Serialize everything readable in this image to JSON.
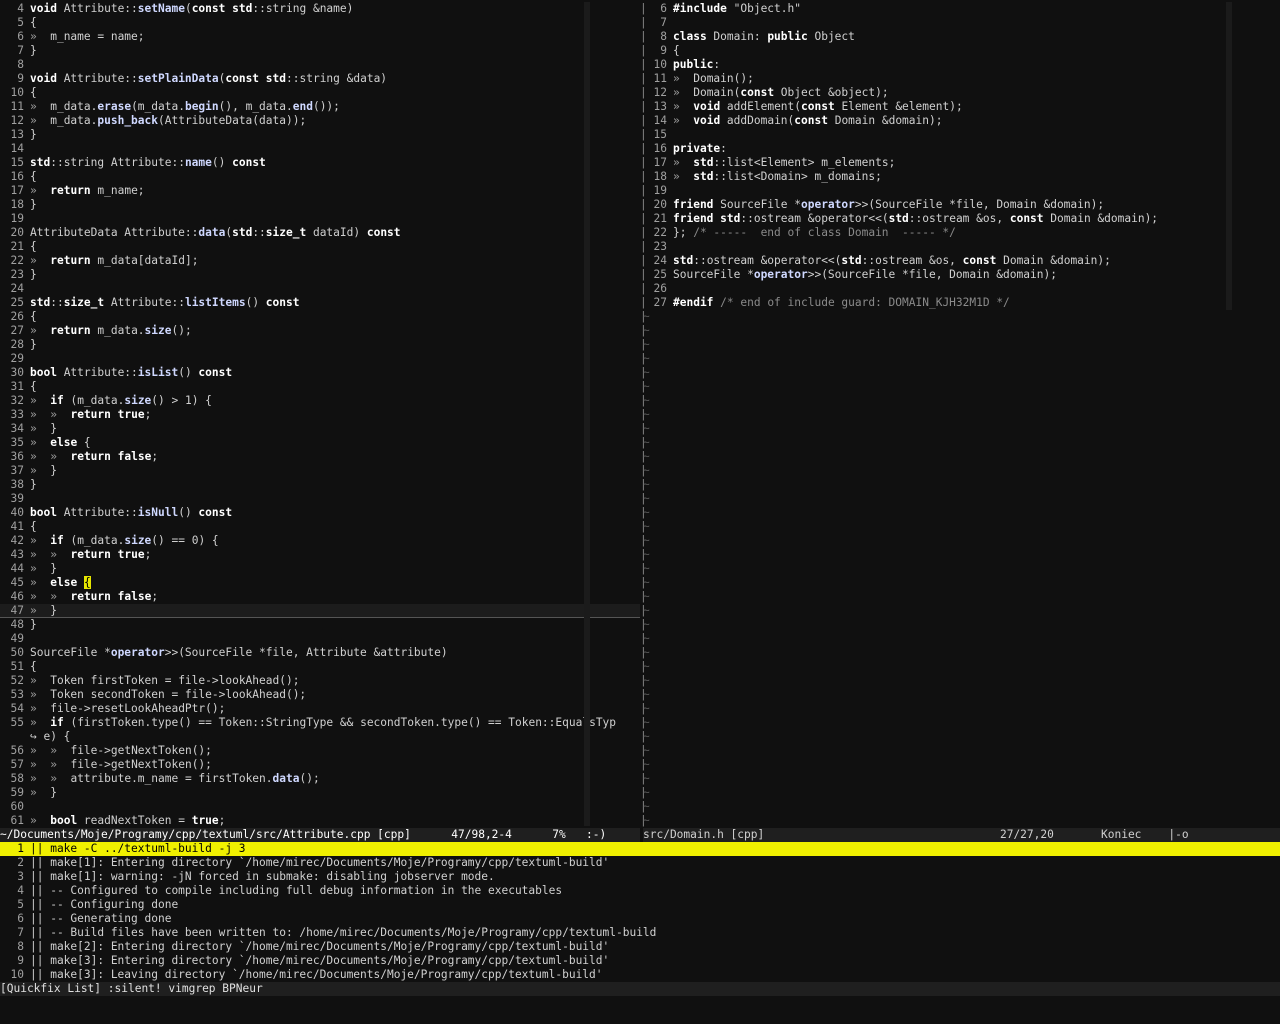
{
  "left_pane": {
    "lines": [
      {
        "n": "4",
        "t": "void Attribute::setName(const std::string &name)"
      },
      {
        "n": "5",
        "t": "{"
      },
      {
        "n": "6",
        "t": "»  m_name = name;"
      },
      {
        "n": "7",
        "t": "}"
      },
      {
        "n": "8",
        "t": ""
      },
      {
        "n": "9",
        "t": "void Attribute::setPlainData(const std::string &data)"
      },
      {
        "n": "10",
        "t": "{"
      },
      {
        "n": "11",
        "t": "»  m_data.erase(m_data.begin(), m_data.end());"
      },
      {
        "n": "12",
        "t": "»  m_data.push_back(AttributeData(data));"
      },
      {
        "n": "13",
        "t": "}"
      },
      {
        "n": "14",
        "t": ""
      },
      {
        "n": "15",
        "t": "std::string Attribute::name() const"
      },
      {
        "n": "16",
        "t": "{"
      },
      {
        "n": "17",
        "t": "»  return m_name;"
      },
      {
        "n": "18",
        "t": "}"
      },
      {
        "n": "19",
        "t": ""
      },
      {
        "n": "20",
        "t": "AttributeData Attribute::data(std::size_t dataId) const"
      },
      {
        "n": "21",
        "t": "{"
      },
      {
        "n": "22",
        "t": "»  return m_data[dataId];"
      },
      {
        "n": "23",
        "t": "}"
      },
      {
        "n": "24",
        "t": ""
      },
      {
        "n": "25",
        "t": "std::size_t Attribute::listItems() const"
      },
      {
        "n": "26",
        "t": "{"
      },
      {
        "n": "27",
        "t": "»  return m_data.size();"
      },
      {
        "n": "28",
        "t": "}"
      },
      {
        "n": "29",
        "t": ""
      },
      {
        "n": "30",
        "t": "bool Attribute::isList() const"
      },
      {
        "n": "31",
        "t": "{"
      },
      {
        "n": "32",
        "t": "»  if (m_data.size() > 1) {"
      },
      {
        "n": "33",
        "t": "»  »  return true;"
      },
      {
        "n": "34",
        "t": "»  }"
      },
      {
        "n": "35",
        "t": "»  else {"
      },
      {
        "n": "36",
        "t": "»  »  return false;"
      },
      {
        "n": "37",
        "t": "»  }"
      },
      {
        "n": "38",
        "t": "}"
      },
      {
        "n": "39",
        "t": ""
      },
      {
        "n": "40",
        "t": "bool Attribute::isNull() const"
      },
      {
        "n": "41",
        "t": "{"
      },
      {
        "n": "42",
        "t": "»  if (m_data.size() == 0) {"
      },
      {
        "n": "43",
        "t": "»  »  return true;"
      },
      {
        "n": "44",
        "t": "»  }"
      },
      {
        "n": "45",
        "t": "»  else {"
      },
      {
        "n": "46",
        "t": "»  »  return false;"
      },
      {
        "n": "47",
        "t": "»  }"
      },
      {
        "n": "48",
        "t": "}"
      },
      {
        "n": "49",
        "t": ""
      },
      {
        "n": "50",
        "t": "SourceFile *operator>>(SourceFile *file, Attribute &attribute)"
      },
      {
        "n": "51",
        "t": "{"
      },
      {
        "n": "52",
        "t": "»  Token firstToken = file->lookAhead();"
      },
      {
        "n": "53",
        "t": "»  Token secondToken = file->lookAhead();"
      },
      {
        "n": "54",
        "t": "»  file->resetLookAheadPtr();"
      },
      {
        "n": "55",
        "t": "»  if (firstToken.type() == Token::StringType && secondToken.type() == Token::EqualsTyp"
      },
      {
        "n": "",
        "t": "↪ e) {"
      },
      {
        "n": "56",
        "t": "»  »  file->getNextToken();"
      },
      {
        "n": "57",
        "t": "»  »  file->getNextToken();"
      },
      {
        "n": "58",
        "t": "»  »  attribute.m_name = firstToken.data();"
      },
      {
        "n": "59",
        "t": "»  }"
      },
      {
        "n": "60",
        "t": ""
      },
      {
        "n": "61",
        "t": "»  bool readNextToken = true;"
      }
    ]
  },
  "right_pane": {
    "lines": [
      {
        "n": "6",
        "t": "#include \"Object.h\""
      },
      {
        "n": "7",
        "t": ""
      },
      {
        "n": "8",
        "t": "class Domain: public Object"
      },
      {
        "n": "9",
        "t": "{"
      },
      {
        "n": "10",
        "t": "public:"
      },
      {
        "n": "11",
        "t": "»  Domain();"
      },
      {
        "n": "12",
        "t": "»  Domain(const Object &object);"
      },
      {
        "n": "13",
        "t": "»  void addElement(const Element &element);"
      },
      {
        "n": "14",
        "t": "»  void addDomain(const Domain &domain);"
      },
      {
        "n": "15",
        "t": ""
      },
      {
        "n": "16",
        "t": "private:"
      },
      {
        "n": "17",
        "t": "»  std::list<Element> m_elements;"
      },
      {
        "n": "18",
        "t": "»  std::list<Domain> m_domains;"
      },
      {
        "n": "19",
        "t": ""
      },
      {
        "n": "20",
        "t": "friend SourceFile *operator>>(SourceFile *file, Domain &domain);"
      },
      {
        "n": "21",
        "t": "friend std::ostream &operator<<(std::ostream &os, const Domain &domain);"
      },
      {
        "n": "22",
        "t": "}; /* -----  end of class Domain  ----- */"
      },
      {
        "n": "23",
        "t": ""
      },
      {
        "n": "24",
        "t": "std::ostream &operator<<(std::ostream &os, const Domain &domain);"
      },
      {
        "n": "25",
        "t": "SourceFile *operator>>(SourceFile *file, Domain &domain);"
      },
      {
        "n": "26",
        "t": ""
      },
      {
        "n": "27",
        "t": "#endif /* end of include guard: DOMAIN_KJH32M1D */"
      }
    ],
    "filler": "~"
  },
  "status_left": "~/Documents/Moje/Programy/cpp/textuml/src/Attribute.cpp [cpp]      47/98,2-4      7%   :-)",
  "status_right": "src/Domain.h [cpp]                                   27/27,20       Koniec    |-o",
  "quickfix": {
    "lines": [
      {
        "n": "1",
        "t": "|| make -C ../textuml-build -j 3"
      },
      {
        "n": "2",
        "t": "|| make[1]: Entering directory `/home/mirec/Documents/Moje/Programy/cpp/textuml-build'"
      },
      {
        "n": "3",
        "t": "|| make[1]: warning: -jN forced in submake: disabling jobserver mode."
      },
      {
        "n": "4",
        "t": "|| -- Configured to compile including full debug information in the executables"
      },
      {
        "n": "5",
        "t": "|| -- Configuring done"
      },
      {
        "n": "6",
        "t": "|| -- Generating done"
      },
      {
        "n": "7",
        "t": "|| -- Build files have been written to: /home/mirec/Documents/Moje/Programy/cpp/textuml-build"
      },
      {
        "n": "8",
        "t": "|| make[2]: Entering directory `/home/mirec/Documents/Moje/Programy/cpp/textuml-build'"
      },
      {
        "n": "9",
        "t": "|| make[3]: Entering directory `/home/mirec/Documents/Moje/Programy/cpp/textuml-build'"
      },
      {
        "n": "10",
        "t": "|| make[3]: Leaving directory `/home/mirec/Documents/Moje/Programy/cpp/textuml-build'"
      }
    ]
  },
  "quickfix_status": "[Quickfix List] :silent! vimgrep BPNeur",
  "colors": {
    "selection": "#f0f000",
    "background": "#101010",
    "statusbar": "#1f1f1f"
  }
}
